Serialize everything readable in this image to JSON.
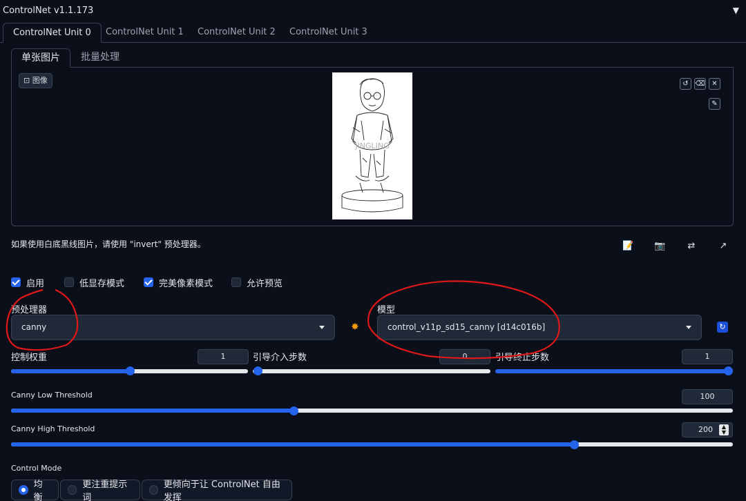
{
  "header": {
    "title": "ControlNet v1.1.173",
    "collapse_icon": "triangle-down-icon"
  },
  "unit_tabs": [
    {
      "label": "ControlNet Unit 0",
      "active": true
    },
    {
      "label": "ControlNet Unit 1",
      "active": false
    },
    {
      "label": "ControlNet Unit 2",
      "active": false
    },
    {
      "label": "ControlNet Unit 3",
      "active": false
    }
  ],
  "image_tabs": [
    {
      "label": "单张图片",
      "active": true
    },
    {
      "label": "批量处理",
      "active": false
    }
  ],
  "image_panel": {
    "label": "图像",
    "watermark": "JINGLING",
    "controls": [
      "undo-icon",
      "eraser-icon",
      "close-icon",
      "brush-icon"
    ]
  },
  "hint_text": "如果使用白底黑线图片，请使用 \"invert\" 预处理器。",
  "tool_icons": [
    "notepad-icon",
    "camera-icon",
    "swap-icon",
    "send-dimensions-icon"
  ],
  "checkboxes": [
    {
      "label": "启用",
      "checked": true
    },
    {
      "label": "低显存模式",
      "checked": false
    },
    {
      "label": "完美像素模式",
      "checked": true
    },
    {
      "label": "允许预览",
      "checked": false
    }
  ],
  "preprocessor": {
    "label": "预处理器",
    "value": "canny"
  },
  "run_preprocessor_icon": "explosion-icon",
  "model": {
    "label": "模型",
    "value": "control_v11p_sd15_canny [d14c016b]"
  },
  "refresh_icon": "refresh-icon",
  "sliders": {
    "weight": {
      "label": "控制权重",
      "value": "1",
      "fraction": 0.5
    },
    "start": {
      "label": "引导介入步数",
      "value": "0",
      "fraction": 0.0
    },
    "end": {
      "label": "引导终止步数",
      "value": "1",
      "fraction": 1.0
    },
    "low": {
      "label": "Canny Low Threshold",
      "value": "100",
      "fraction": 0.392
    },
    "high": {
      "label": "Canny High Threshold",
      "value": "200",
      "fraction": 0.784
    }
  },
  "control_mode": {
    "label": "Control Mode",
    "options": [
      {
        "label": "均衡",
        "selected": true
      },
      {
        "label": "更注重提示词",
        "selected": false
      },
      {
        "label": "更倾向于让 ControlNet 自由发挥",
        "selected": false
      }
    ]
  },
  "colors": {
    "background": "#0b0f19",
    "accent": "#2563eb",
    "annotation": "#e01818"
  }
}
